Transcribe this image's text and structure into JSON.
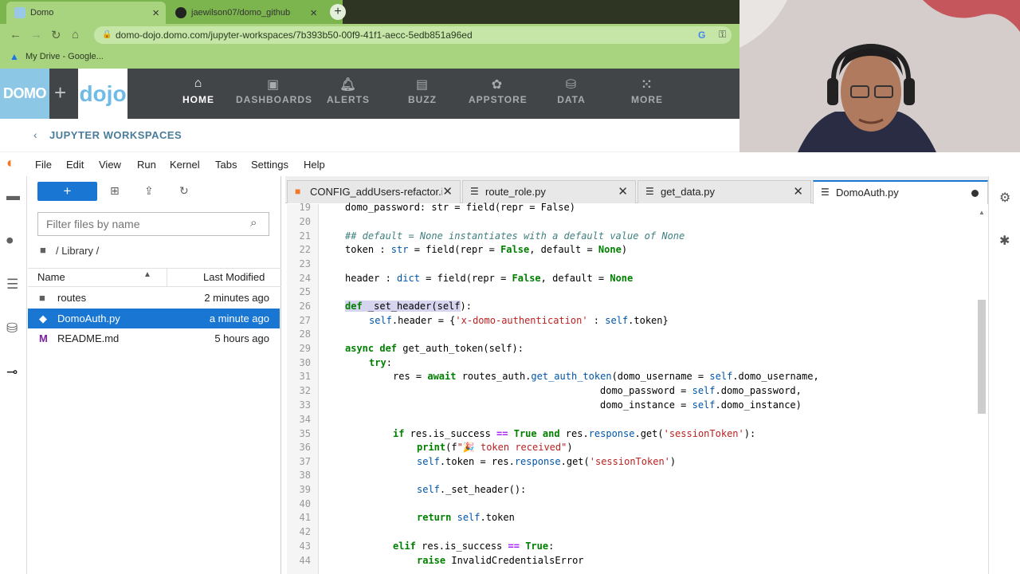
{
  "browser": {
    "tabs": [
      {
        "title": "Domo",
        "active": true
      },
      {
        "title": "jaewilson07/domo_github",
        "active": false
      }
    ],
    "url": "domo-dojo.domo.com/jupyter-workspaces/7b393b50-00f9-41f1-aecc-5edb851a96ed",
    "bookmark": "My Drive - Google..."
  },
  "domo": {
    "logo": "DOMO",
    "plus": "+",
    "dojo": "dojo",
    "nav": [
      {
        "label": "HOME",
        "icon": "home-icon",
        "active": true
      },
      {
        "label": "DASHBOARDS",
        "icon": "dashboards-icon",
        "active": false
      },
      {
        "label": "ALERTS",
        "icon": "bell-icon",
        "active": false
      },
      {
        "label": "BUZZ",
        "icon": "chat-icon",
        "active": false
      },
      {
        "label": "APPSTORE",
        "icon": "appstore-icon",
        "active": false
      },
      {
        "label": "DATA",
        "icon": "database-icon",
        "active": false
      },
      {
        "label": "MORE",
        "icon": "grid-icon",
        "active": false
      }
    ],
    "workspaces_label": "JUPYTER WORKSPACES"
  },
  "jupyter": {
    "menu": [
      "File",
      "Edit",
      "View",
      "Run",
      "Kernel",
      "Tabs",
      "Settings",
      "Help"
    ],
    "filebrowser": {
      "new_label": "+",
      "filter_placeholder": "Filter files by name",
      "breadcrumb": "/ Library /",
      "col_name": "Name",
      "col_modified": "Last Modified",
      "files": [
        {
          "name": "routes",
          "modified": "2 minutes ago",
          "type": "folder",
          "selected": false
        },
        {
          "name": "DomoAuth.py",
          "modified": "a minute ago",
          "type": "python",
          "selected": true
        },
        {
          "name": "README.md",
          "modified": "5 hours ago",
          "type": "markdown",
          "selected": false
        }
      ]
    },
    "tabs": [
      {
        "label": "CONFIG_addUsers-refactor.i",
        "icon": "notebook-icon",
        "active": false
      },
      {
        "label": "route_role.py",
        "icon": "file-icon",
        "active": false
      },
      {
        "label": "get_data.py",
        "icon": "file-icon",
        "active": false
      },
      {
        "label": "DomoAuth.py",
        "icon": "file-icon",
        "active": true
      }
    ],
    "line_numbers": [
      "19",
      "20",
      "21",
      "22",
      "23",
      "24",
      "25",
      "26",
      "27",
      "28",
      "29",
      "30",
      "31",
      "32",
      "33",
      "34",
      "35",
      "36",
      "37",
      "38",
      "39",
      "40",
      "41",
      "42",
      "43",
      "44"
    ]
  }
}
